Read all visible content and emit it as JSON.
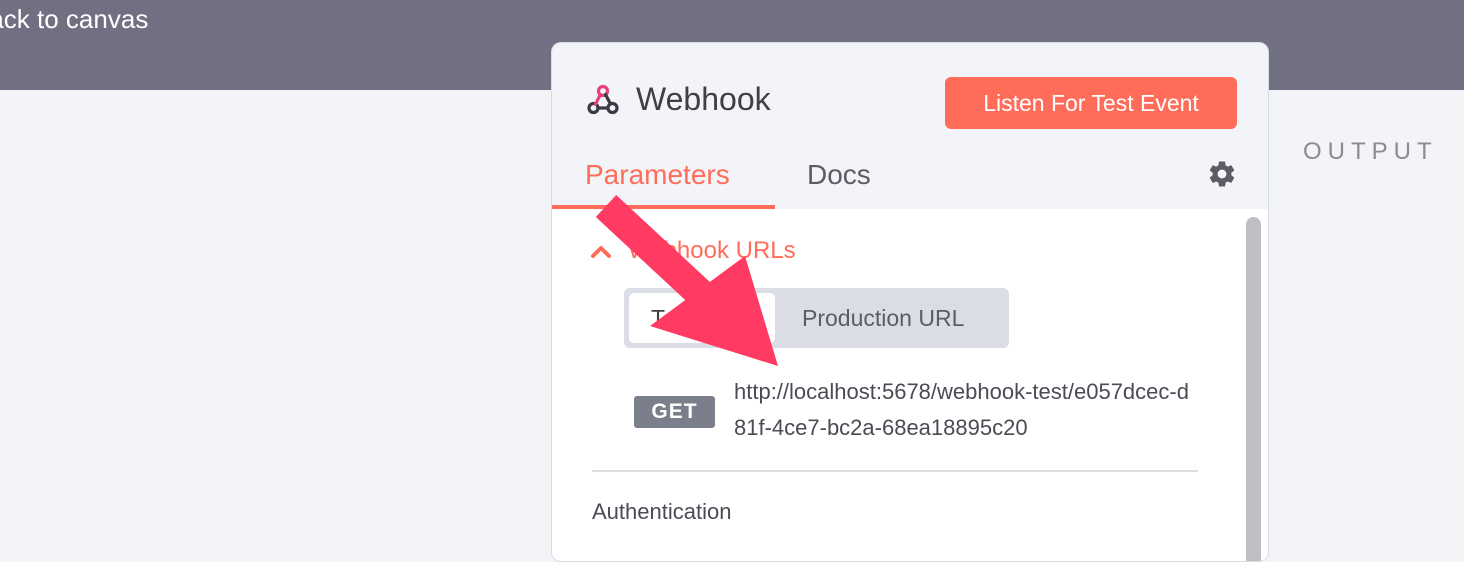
{
  "topbar": {
    "back_label": "Back to canvas"
  },
  "output": {
    "label": "OUTPUT"
  },
  "node": {
    "title": "Webhook",
    "icon": "webhook-icon",
    "listen_button_label": "Listen For Test Event"
  },
  "tabs": [
    {
      "label": "Parameters",
      "active": true
    },
    {
      "label": "Docs",
      "active": false
    }
  ],
  "settings": {
    "icon": "gear-icon"
  },
  "webhook_urls": {
    "section_title": "Webhook URLs",
    "toggle": {
      "test_label": "Test URL",
      "production_label": "Production URL",
      "selected": "Test URL"
    },
    "method": "GET",
    "url": "http://localhost:5678/webhook-test/e057dcec-d81f-4ce7-bc2a-68ea18895c20"
  },
  "fields": {
    "authentication_label": "Authentication"
  },
  "colors": {
    "accent": "#ff6d5a",
    "topbar": "#717083",
    "annotation_arrow": "#ff3b63"
  }
}
